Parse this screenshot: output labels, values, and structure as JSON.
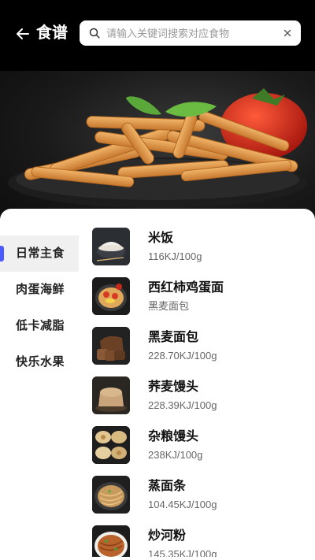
{
  "header": {
    "title": "食谱",
    "back_icon": "arrow-left-icon",
    "search": {
      "placeholder": "请输入关键词搜索对应食物",
      "value": "",
      "icon": "search-icon",
      "clear_icon": "close-icon"
    }
  },
  "hero": {
    "image": "fried-pasta-with-basil-and-tomato"
  },
  "accent_color": "#4a5cff",
  "categories": [
    {
      "label": "日常主食",
      "active": true
    },
    {
      "label": "肉蛋海鲜",
      "active": false
    },
    {
      "label": "低卡减脂",
      "active": false
    },
    {
      "label": "快乐水果",
      "active": false
    }
  ],
  "foods": [
    {
      "name": "米饭",
      "sub": "116KJ/100g",
      "image": "rice-bowl"
    },
    {
      "name": "西红柿鸡蛋面",
      "sub": "黑麦面包",
      "image": "tomato-egg-noodles"
    },
    {
      "name": "黑麦面包",
      "sub": "228.70KJ/100g",
      "image": "rye-bread"
    },
    {
      "name": "荞麦馒头",
      "sub": "228.39KJ/100g",
      "image": "buckwheat-bun"
    },
    {
      "name": "杂粮馒头",
      "sub": "238KJ/100g",
      "image": "multigrain-buns"
    },
    {
      "name": "蒸面条",
      "sub": "104.45KJ/100g",
      "image": "steamed-noodles"
    },
    {
      "name": "炒河粉",
      "sub": "145.35KJ/100g",
      "image": "fried-rice-noodles"
    }
  ]
}
